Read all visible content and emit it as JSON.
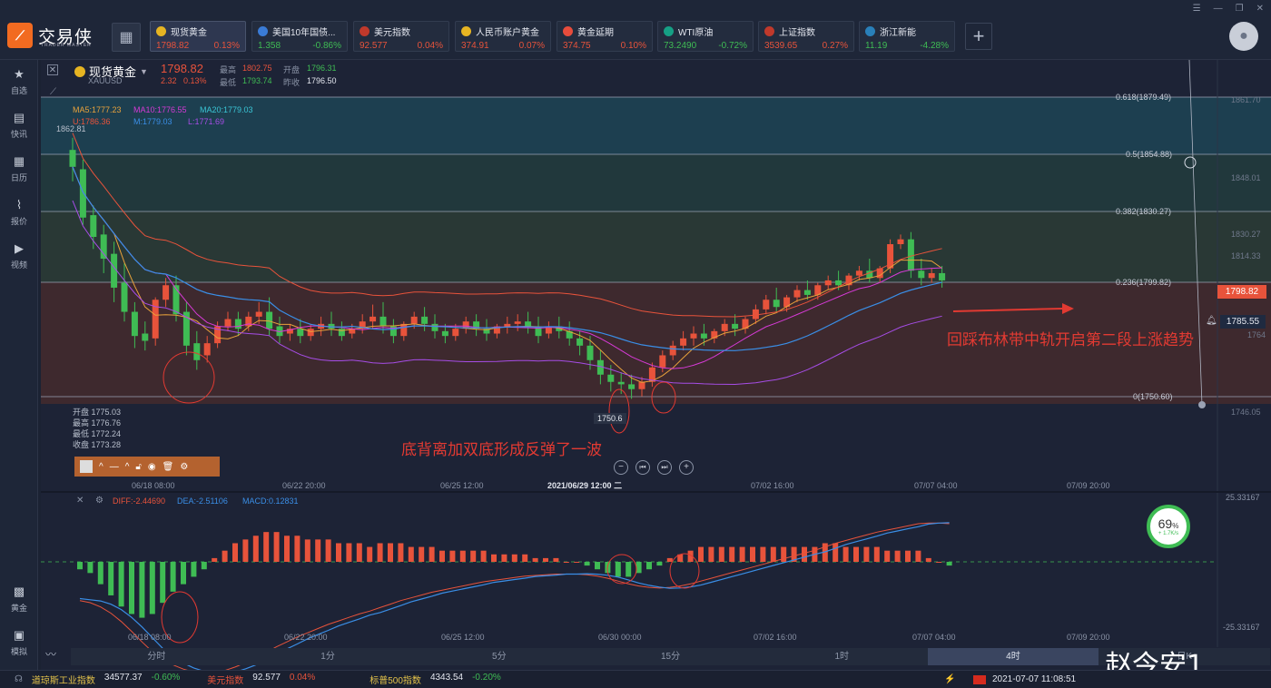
{
  "app": {
    "logo_text": "交易侠",
    "logo_sub": "TRADER MASTER"
  },
  "tabs": [
    {
      "name": "现货黄金",
      "price": "1798.82",
      "change": "0.13%",
      "dir": "up",
      "icon_color": "#e6b422"
    },
    {
      "name": "美国10年国债...",
      "price": "1.358",
      "change": "-0.86%",
      "dir": "dn",
      "icon_color": "#3a7bd5"
    },
    {
      "name": "美元指数",
      "price": "92.577",
      "change": "0.04%",
      "dir": "up",
      "icon_color": "#c0392b"
    },
    {
      "name": "人民币账户黄金",
      "price": "374.91",
      "change": "0.07%",
      "dir": "up",
      "icon_color": "#e6b422"
    },
    {
      "name": "黄金延期",
      "price": "374.75",
      "change": "0.10%",
      "dir": "up",
      "icon_color": "#e74c3c"
    },
    {
      "name": "WTI原油",
      "price": "73.2490",
      "change": "-0.72%",
      "dir": "dn",
      "icon_color": "#16a085"
    },
    {
      "name": "上证指数",
      "price": "3539.65",
      "change": "0.27%",
      "dir": "up",
      "icon_color": "#c0392b"
    },
    {
      "name": "浙江新能",
      "price": "11.19",
      "change": "-4.28%",
      "dir": "dn",
      "icon_color": "#2980b9"
    }
  ],
  "sidebar": [
    {
      "label": "自选",
      "icon": "star-icon"
    },
    {
      "label": "快讯",
      "icon": "news-icon"
    },
    {
      "label": "日历",
      "icon": "calendar-icon"
    },
    {
      "label": "报价",
      "icon": "quote-icon"
    },
    {
      "label": "视频",
      "icon": "video-icon"
    }
  ],
  "sidebar_bottom": [
    {
      "label": "黄金",
      "icon": "gold-icon"
    },
    {
      "label": "模拟",
      "icon": "wallet-icon"
    }
  ],
  "header": {
    "symbol": "现货黄金",
    "code": "XAUUSD",
    "price": "1798.82",
    "change": "2.32",
    "pct": "0.13%",
    "high_label": "最高",
    "high": "1802.75",
    "low_label": "最低",
    "low": "1793.74",
    "open_label": "开盘",
    "open": "1796.31",
    "prev_label": "昨收",
    "prev": "1796.50"
  },
  "ma": {
    "ma5": "MA5:1777.23",
    "ma10": "MA10:1776.55",
    "ma20": "MA20:1779.03",
    "u": "U:1786.36",
    "m": "M:1779.03",
    "l": "L:1771.69"
  },
  "top_price_label": "1862.81",
  "fib": [
    {
      "label": "0.618(1879.49)",
      "price": "1861.70"
    },
    {
      "label": "0.5(1854.88)",
      "price": "1848.01"
    },
    {
      "label": "0.382(1830.27)",
      "price": "1830.27"
    },
    {
      "label": "0.236(1799.82)",
      "price": "1814.33"
    },
    {
      "label": "0(1750.60)",
      "price": "1746.05"
    }
  ],
  "right_axis": {
    "current": "1798.82",
    "bell": "1785.55",
    "p1764": "1764"
  },
  "ohlc": {
    "open": "开盘 1775.03",
    "high": "最高 1776.76",
    "low": "最低 1772.24",
    "close": "收盘 1773.28"
  },
  "low_mark": "1750.6",
  "annotations": {
    "left": "底背离加双底形成反弹了一波",
    "right": "回踩布林带中轨开启第二段上涨趋势"
  },
  "x_labels": [
    "06/18 08:00",
    "06/22 20:00",
    "06/25 12:00",
    "2021/06/29 12:00 二",
    "07/02 16:00",
    "07/07 04:00",
    "07/09 20:00"
  ],
  "x_labels_macd": [
    "06/18 08:00",
    "06/22 20:00",
    "06/25 12:00",
    "06/30 00:00",
    "07/02 16:00",
    "07/07 04:00",
    "07/09 20:00"
  ],
  "macd": {
    "diff": "DIFF:-2.44690",
    "dea": "DEA:-2.51106",
    "macd": "MACD:0.12831",
    "top": "25.33167",
    "bottom": "-25.33167"
  },
  "gauge": {
    "pct": "69",
    "unit": "%",
    "speed": "+ 1.7K/s"
  },
  "timeframes": [
    "分时",
    "1分",
    "5分",
    "15分",
    "1时",
    "4时",
    "日K"
  ],
  "active_timeframe": "4时",
  "bottom": [
    {
      "name": "道琼斯工业指数",
      "val": "34577.37",
      "chg": "-0.60%",
      "dir": "dn"
    },
    {
      "name": "美元指数",
      "val": "92.577",
      "chg": "0.04%",
      "dir": "up"
    },
    {
      "name": "标普500指数",
      "val": "4343.54",
      "chg": "-0.20%",
      "dir": "dn"
    }
  ],
  "datetime": "2021-07-07 11:08:51",
  "watermark": "赵今安1",
  "colors": {
    "up": "#e8533b",
    "down": "#3fbc54",
    "accent": "#f26b21"
  },
  "chart_data": {
    "type": "candlestick",
    "candles": [
      [
        1853,
        1858,
        1846,
        1840
      ],
      [
        1845,
        1849,
        1825,
        1822
      ],
      [
        1826,
        1830,
        1817,
        1812
      ],
      [
        1818,
        1822,
        1808,
        1802
      ],
      [
        1810,
        1815,
        1796,
        1790
      ],
      [
        1798,
        1806,
        1786,
        1782
      ],
      [
        1786,
        1790,
        1776,
        1771
      ],
      [
        1777,
        1782,
        1774,
        1770
      ],
      [
        1775,
        1792,
        1791,
        1772
      ],
      [
        1791,
        1800,
        1797,
        1788
      ],
      [
        1797,
        1801,
        1785,
        1782
      ],
      [
        1786,
        1790,
        1772,
        1768
      ],
      [
        1773,
        1778,
        1766,
        1762
      ],
      [
        1768,
        1776,
        1773,
        1765
      ],
      [
        1773,
        1782,
        1780,
        1771
      ],
      [
        1780,
        1786,
        1783,
        1778
      ],
      [
        1783,
        1786,
        1779,
        1776
      ],
      [
        1780,
        1786,
        1784,
        1778
      ],
      [
        1784,
        1790,
        1786,
        1781
      ],
      [
        1786,
        1792,
        1779,
        1776
      ],
      [
        1780,
        1784,
        1776,
        1773
      ],
      [
        1777,
        1781,
        1779,
        1774
      ],
      [
        1779,
        1783,
        1776,
        1773
      ],
      [
        1776,
        1781,
        1779,
        1774
      ],
      [
        1779,
        1784,
        1781,
        1776
      ],
      [
        1781,
        1786,
        1779,
        1776
      ],
      [
        1779,
        1782,
        1776,
        1774
      ],
      [
        1777,
        1781,
        1779,
        1775
      ],
      [
        1779,
        1785,
        1782,
        1777
      ],
      [
        1782,
        1789,
        1784,
        1779
      ],
      [
        1784,
        1790,
        1780,
        1777
      ],
      [
        1780,
        1783,
        1776,
        1773
      ],
      [
        1776,
        1782,
        1781,
        1774
      ],
      [
        1781,
        1786,
        1784,
        1779
      ],
      [
        1784,
        1788,
        1781,
        1778
      ],
      [
        1781,
        1785,
        1778,
        1775
      ],
      [
        1778,
        1781,
        1776,
        1773
      ],
      [
        1776,
        1781,
        1779,
        1774
      ],
      [
        1779,
        1784,
        1782,
        1777
      ],
      [
        1782,
        1785,
        1779,
        1776
      ],
      [
        1779,
        1783,
        1777,
        1774
      ],
      [
        1777,
        1781,
        1780,
        1775
      ],
      [
        1780,
        1784,
        1781,
        1777
      ],
      [
        1781,
        1785,
        1782,
        1778
      ],
      [
        1782,
        1786,
        1780,
        1777
      ],
      [
        1780,
        1784,
        1776,
        1773
      ],
      [
        1777,
        1782,
        1780,
        1775
      ],
      [
        1780,
        1784,
        1778,
        1775
      ],
      [
        1778,
        1782,
        1775,
        1772
      ],
      [
        1775,
        1778,
        1772,
        1768
      ],
      [
        1772,
        1776,
        1766,
        1762
      ],
      [
        1766,
        1770,
        1760,
        1756
      ],
      [
        1760,
        1764,
        1757,
        1753
      ],
      [
        1757,
        1761,
        1756,
        1752
      ],
      [
        1756,
        1760,
        1754,
        1750
      ],
      [
        1754,
        1759,
        1757,
        1751
      ],
      [
        1757,
        1765,
        1763,
        1755
      ],
      [
        1763,
        1770,
        1768,
        1761
      ],
      [
        1768,
        1774,
        1772,
        1766
      ],
      [
        1772,
        1778,
        1775,
        1770
      ],
      [
        1775,
        1780,
        1777,
        1772
      ],
      [
        1777,
        1781,
        1775,
        1772
      ],
      [
        1775,
        1779,
        1778,
        1773
      ],
      [
        1778,
        1783,
        1781,
        1776
      ],
      [
        1781,
        1785,
        1779,
        1776
      ],
      [
        1779,
        1784,
        1783,
        1777
      ],
      [
        1783,
        1789,
        1787,
        1781
      ],
      [
        1787,
        1793,
        1791,
        1785
      ],
      [
        1791,
        1796,
        1788,
        1786
      ],
      [
        1788,
        1793,
        1792,
        1786
      ],
      [
        1792,
        1797,
        1795,
        1790
      ],
      [
        1795,
        1799,
        1793,
        1791
      ],
      [
        1793,
        1798,
        1797,
        1791
      ],
      [
        1797,
        1801,
        1799,
        1795
      ],
      [
        1799,
        1803,
        1797,
        1795
      ],
      [
        1797,
        1802,
        1801,
        1795
      ],
      [
        1801,
        1805,
        1803,
        1799
      ],
      [
        1803,
        1808,
        1800,
        1798
      ],
      [
        1800,
        1805,
        1804,
        1798
      ],
      [
        1804,
        1816,
        1814,
        1802
      ],
      [
        1814,
        1818,
        1816,
        1812
      ],
      [
        1816,
        1819,
        1803,
        1800
      ],
      [
        1803,
        1808,
        1800,
        1797
      ],
      [
        1800,
        1804,
        1802,
        1798
      ],
      [
        1802,
        1805,
        1799,
        1796
      ]
    ],
    "price_range": [
      1740,
      1885
    ],
    "macd_hist": [
      -2,
      -3,
      -6,
      -9,
      -12,
      -14,
      -15,
      -14,
      -11,
      -8,
      -6,
      -4,
      -2,
      1,
      3,
      5,
      6,
      7,
      8,
      8,
      7,
      7,
      6,
      6,
      6,
      5,
      5,
      5,
      4,
      5,
      5,
      5,
      4,
      4,
      4,
      3,
      3,
      3,
      3,
      3,
      2,
      2,
      2,
      2,
      1,
      1,
      1,
      0,
      0,
      -1,
      -2,
      -3,
      -4,
      -4,
      -3,
      -2,
      -1,
      1,
      2,
      3,
      4,
      4,
      4,
      4,
      4,
      4,
      4,
      4,
      4,
      4,
      4,
      4,
      5,
      5,
      4,
      4,
      4,
      4,
      3,
      3,
      3,
      3,
      1,
      0,
      -1
    ],
    "macd_range": [
      -25.33,
      25.33
    ]
  }
}
